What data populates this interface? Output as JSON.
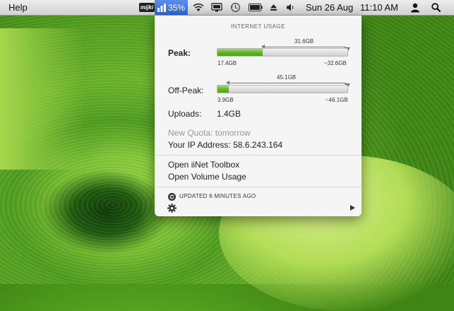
{
  "menubar": {
    "app_menu": "Help",
    "mijki_label": "mijki",
    "usage_percent": "35%",
    "date": "Sun 26 Aug",
    "time": "11:10 AM"
  },
  "popup": {
    "title": "INTERNET USAGE",
    "peak": {
      "label": "Peak:",
      "used": "17.4GB",
      "remaining": "31.6GB",
      "limit": "~32.6GB",
      "fraction_used": 0.35
    },
    "offpeak": {
      "label": "Off-Peak:",
      "used": "3.9GB",
      "remaining": "45.1GB",
      "limit": "~46.1GB",
      "fraction_used": 0.085
    },
    "uploads_label": "Uploads:",
    "uploads_value": "1.4GB",
    "new_quota": "New Quota: tomorrow",
    "ip_address": "Your IP Address: 58.6.243.164",
    "open_toolbox": "Open iiNet Toolbox",
    "open_volume": "Open Volume Usage",
    "updated": "UPDATED 6 MINUTES AGO"
  },
  "colors": {
    "bar_fill": "#5db52b",
    "menu_highlight": "#3a72e0"
  }
}
